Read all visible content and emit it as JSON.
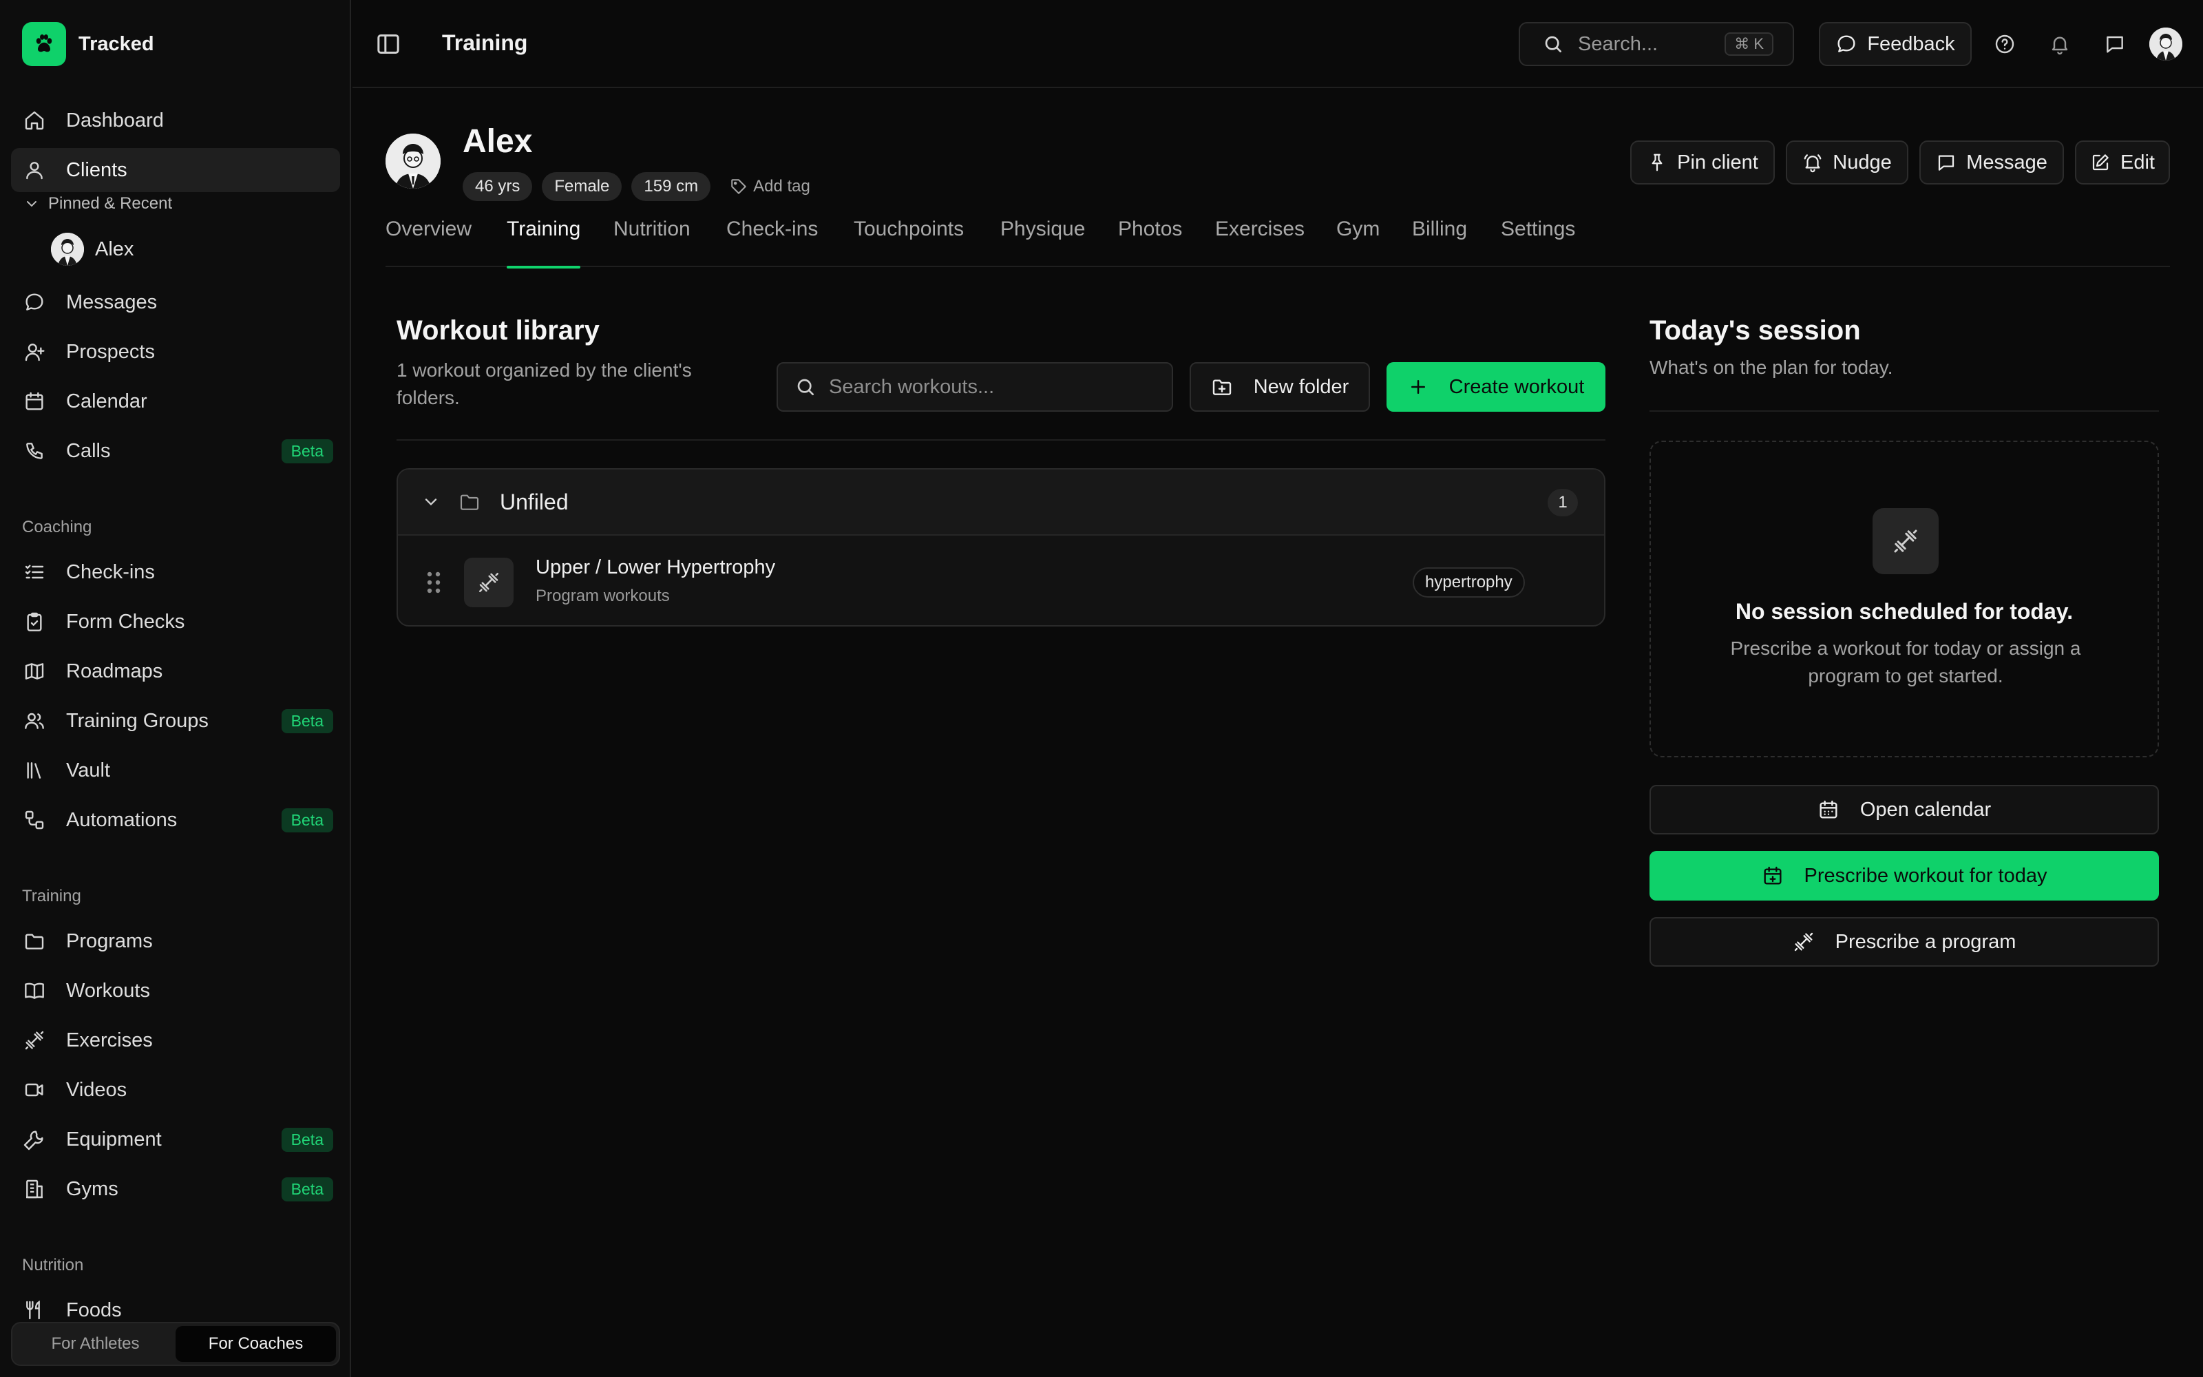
{
  "app": {
    "name": "Tracked"
  },
  "colors": {
    "accent": "#0fd16a",
    "background": "#0a0a0a",
    "beta_bg": "#0c3a22"
  },
  "sidebar": {
    "main_items": [
      {
        "label": "Dashboard",
        "icon": "home-icon"
      },
      {
        "label": "Clients",
        "icon": "user-icon",
        "active": true
      },
      {
        "label": "Messages",
        "icon": "message-icon"
      },
      {
        "label": "Prospects",
        "icon": "user-plus-icon"
      },
      {
        "label": "Calendar",
        "icon": "calendar-icon"
      },
      {
        "label": "Calls",
        "icon": "phone-icon",
        "badge": "Beta"
      }
    ],
    "pinned_label": "Pinned & Recent",
    "pinned_clients": [
      {
        "name": "Alex"
      }
    ],
    "coaching_label": "Coaching",
    "coaching_items": [
      {
        "label": "Check-ins",
        "icon": "checklist-icon"
      },
      {
        "label": "Form Checks",
        "icon": "clipboard-check-icon"
      },
      {
        "label": "Roadmaps",
        "icon": "map-icon"
      },
      {
        "label": "Training Groups",
        "icon": "users-icon",
        "badge": "Beta"
      },
      {
        "label": "Vault",
        "icon": "library-icon"
      },
      {
        "label": "Automations",
        "icon": "workflow-icon",
        "badge": "Beta"
      }
    ],
    "training_label": "Training",
    "training_items": [
      {
        "label": "Programs",
        "icon": "folder-icon"
      },
      {
        "label": "Workouts",
        "icon": "book-icon"
      },
      {
        "label": "Exercises",
        "icon": "dumbbell-icon"
      },
      {
        "label": "Videos",
        "icon": "video-icon"
      },
      {
        "label": "Equipment",
        "icon": "wrench-icon",
        "badge": "Beta"
      },
      {
        "label": "Gyms",
        "icon": "building-icon",
        "badge": "Beta"
      }
    ],
    "nutrition_label": "Nutrition",
    "nutrition_items": [
      {
        "label": "Foods",
        "icon": "food-icon"
      }
    ],
    "mode_switch": {
      "athletes": "For Athletes",
      "coaches": "For Coaches",
      "selected": "For Coaches"
    }
  },
  "topbar": {
    "title": "Training",
    "search_placeholder": "Search...",
    "search_shortcut": "⌘ K",
    "feedback_label": "Feedback"
  },
  "client": {
    "name": "Alex",
    "age": "46 yrs",
    "sex": "Female",
    "height": "159 cm",
    "add_tag_label": "Add tag",
    "actions": {
      "pin": "Pin client",
      "nudge": "Nudge",
      "message": "Message",
      "edit": "Edit"
    },
    "tabs": [
      "Overview",
      "Training",
      "Nutrition",
      "Check-ins",
      "Touchpoints",
      "Physique",
      "Photos",
      "Exercises",
      "Gym",
      "Billing",
      "Settings"
    ],
    "active_tab": "Training"
  },
  "library": {
    "title": "Workout library",
    "subtitle": "1 workout organized by the client's folders.",
    "search_placeholder": "Search workouts...",
    "new_folder_label": "New folder",
    "create_label": "Create workout",
    "folder": {
      "name": "Unfiled",
      "count": "1",
      "workouts": [
        {
          "name": "Upper / Lower Hypertrophy",
          "subtitle": "Program workouts",
          "tag": "hypertrophy"
        }
      ]
    }
  },
  "session": {
    "title": "Today's session",
    "subtitle": "What's on the plan for today.",
    "empty_title": "No session scheduled for today.",
    "empty_desc": "Prescribe a workout for today or assign a program to get started.",
    "open_calendar": "Open calendar",
    "prescribe_workout": "Prescribe workout for today",
    "prescribe_program": "Prescribe a program"
  }
}
